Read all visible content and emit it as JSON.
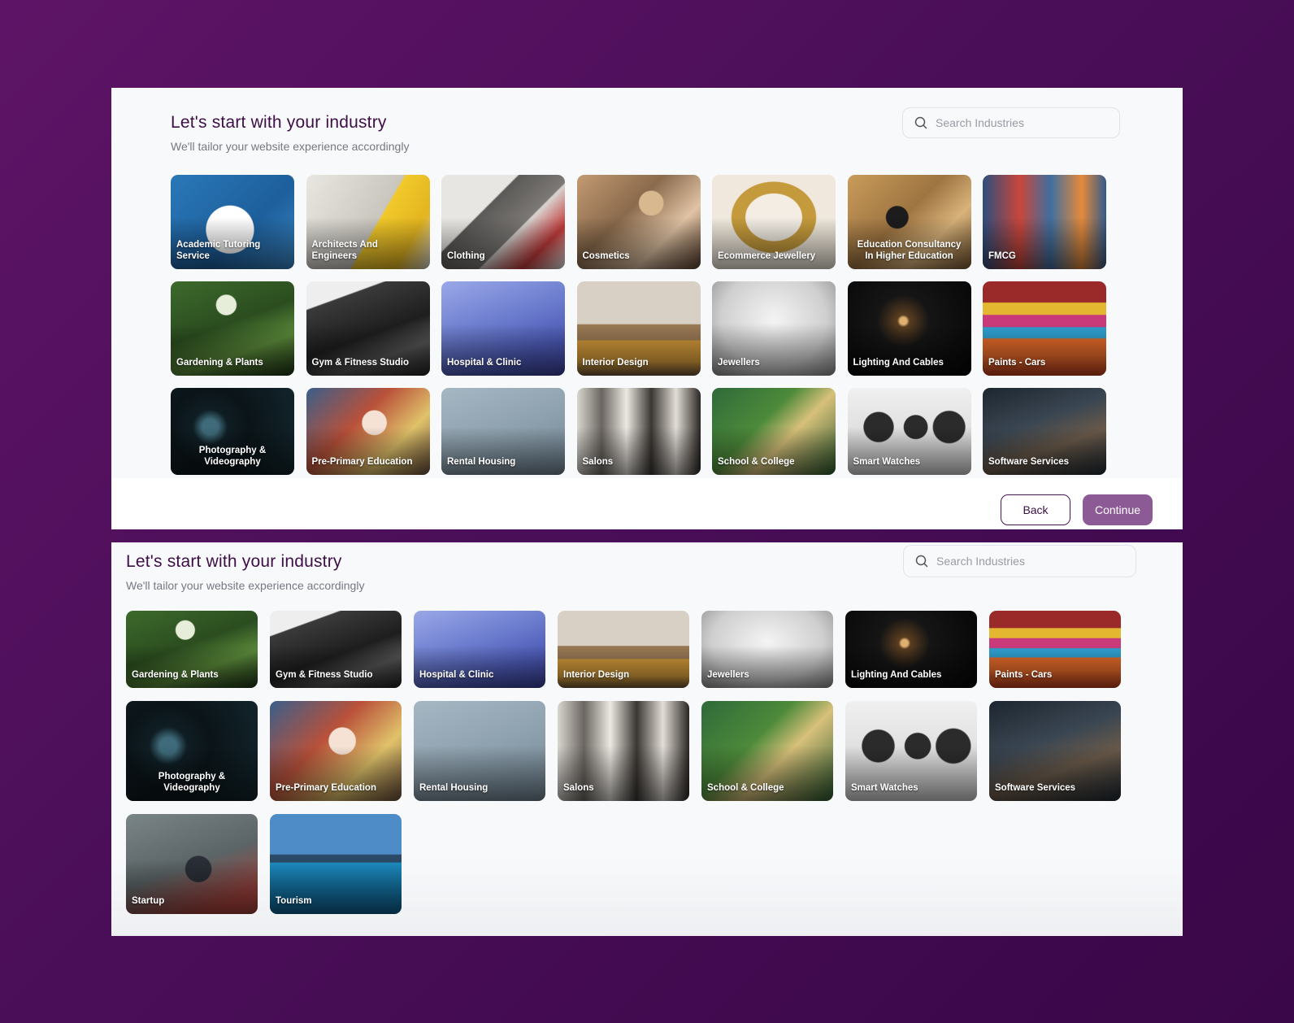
{
  "screen_top": {
    "title": "Let's start with your industry",
    "subtitle": "We'll tailor your website experience accordingly",
    "search_placeholder": "Search Industries",
    "industries": [
      "Academic Tutoring Service",
      "Architects And Engineers",
      "Clothing",
      "Cosmetics",
      "Ecommerce Jewellery",
      "Education Consultancy In Higher Education",
      "FMCG",
      "Gardening & Plants",
      "Gym & Fitness Studio",
      "Hospital & Clinic",
      "Interior Design",
      "Jewellers",
      "Lighting And Cables",
      "Paints - Cars",
      "Photography & Videography",
      "Pre-Primary Education",
      "Rental Housing",
      "Salons",
      "School & College",
      "Smart Watches",
      "Software Services"
    ],
    "back_label": "Back",
    "continue_label": "Continue"
  },
  "screen_bottom": {
    "title": "Let's start with your industry",
    "subtitle": "We'll tailor your website experience accordingly",
    "search_placeholder": "Search Industries",
    "industries": [
      "Gardening & Plants",
      "Gym & Fitness Studio",
      "Hospital & Clinic",
      "Interior Design",
      "Jewellers",
      "Lighting And Cables",
      "Paints - Cars",
      "Photography & Videography",
      "Pre-Primary Education",
      "Rental Housing",
      "Salons",
      "School & College",
      "Smart Watches",
      "Software Services",
      "Startup",
      "Tourism"
    ]
  },
  "colors": {
    "background": "#4a0e58",
    "title": "#3d0f46",
    "continue_button": "#8c5a95"
  },
  "icons": [
    "search-icon"
  ]
}
